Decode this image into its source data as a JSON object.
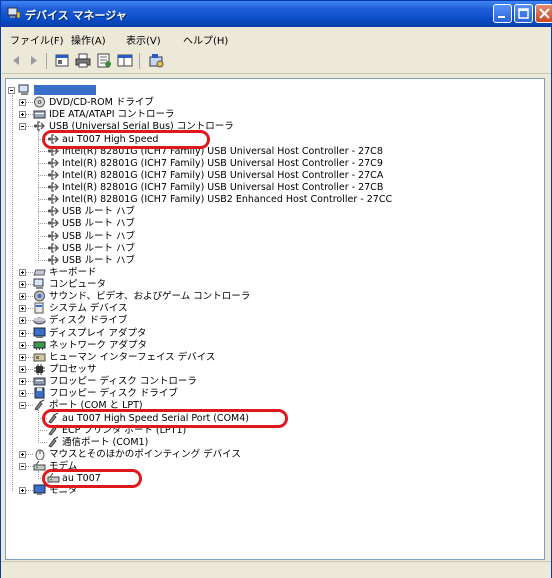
{
  "window": {
    "title": "デバイス マネージャ"
  },
  "menu": [
    "ファイル(F)",
    "操作(A)",
    "表示(V)",
    "ヘルプ(H)"
  ],
  "toolbar": [
    "back-icon",
    "forward-icon",
    "show-icon",
    "print-icon",
    "properties-icon",
    "view-icon",
    "scan-icon"
  ],
  "tree": [
    {
      "label": "",
      "level": 0,
      "expander": "minus",
      "icon": "computer-icon",
      "kind": "root"
    },
    {
      "label": "DVD/CD-ROM ドライブ",
      "level": 1,
      "expander": "plus",
      "icon": "cdrom-icon"
    },
    {
      "label": "IDE ATA/ATAPI コントローラ",
      "level": 1,
      "expander": "plus",
      "icon": "ide-icon"
    },
    {
      "label": "USB (Universal Serial Bus) コントローラ",
      "level": 1,
      "expander": "minus",
      "icon": "usb-icon"
    },
    {
      "label": "au T007 High Speed",
      "level": 2,
      "icon": "usb-icon"
    },
    {
      "label": "Intel(R) 82801G (ICH7 Family) USB Universal Host Controller - 27C8",
      "level": 2,
      "icon": "usb-icon"
    },
    {
      "label": "Intel(R) 82801G (ICH7 Family) USB Universal Host Controller - 27C9",
      "level": 2,
      "icon": "usb-icon"
    },
    {
      "label": "Intel(R) 82801G (ICH7 Family) USB Universal Host Controller - 27CA",
      "level": 2,
      "icon": "usb-icon"
    },
    {
      "label": "Intel(R) 82801G (ICH7 Family) USB Universal Host Controller - 27CB",
      "level": 2,
      "icon": "usb-icon"
    },
    {
      "label": "Intel(R) 82801G (ICH7 Family) USB2 Enhanced Host Controller - 27CC",
      "level": 2,
      "icon": "usb-icon"
    },
    {
      "label": "USB ルート ハブ",
      "level": 2,
      "icon": "usb-icon"
    },
    {
      "label": "USB ルート ハブ",
      "level": 2,
      "icon": "usb-icon"
    },
    {
      "label": "USB ルート ハブ",
      "level": 2,
      "icon": "usb-icon"
    },
    {
      "label": "USB ルート ハブ",
      "level": 2,
      "icon": "usb-icon"
    },
    {
      "label": "USB ルート ハブ",
      "level": 2,
      "icon": "usb-icon"
    },
    {
      "label": "キーボード",
      "level": 1,
      "expander": "plus",
      "icon": "keyboard-icon"
    },
    {
      "label": "コンピュータ",
      "level": 1,
      "expander": "plus",
      "icon": "computer-icon"
    },
    {
      "label": "サウンド、ビデオ、およびゲーム コントローラ",
      "level": 1,
      "expander": "plus",
      "icon": "sound-icon"
    },
    {
      "label": "システム デバイス",
      "level": 1,
      "expander": "plus",
      "icon": "system-icon"
    },
    {
      "label": "ディスク ドライブ",
      "level": 1,
      "expander": "plus",
      "icon": "disk-icon"
    },
    {
      "label": "ディスプレイ アダプタ",
      "level": 1,
      "expander": "plus",
      "icon": "display-icon"
    },
    {
      "label": "ネットワーク アダプタ",
      "level": 1,
      "expander": "plus",
      "icon": "network-icon"
    },
    {
      "label": "ヒューマン インターフェイス デバイス",
      "level": 1,
      "expander": "plus",
      "icon": "hid-icon"
    },
    {
      "label": "プロセッサ",
      "level": 1,
      "expander": "plus",
      "icon": "cpu-icon"
    },
    {
      "label": "フロッピー ディスク コントローラ",
      "level": 1,
      "expander": "plus",
      "icon": "floppy-controller-icon"
    },
    {
      "label": "フロッピー ディスク ドライブ",
      "level": 1,
      "expander": "plus",
      "icon": "floppy-icon"
    },
    {
      "label": "ポート (COM と LPT)",
      "level": 1,
      "expander": "minus",
      "icon": "port-icon"
    },
    {
      "label": "au T007 High Speed Serial Port  (COM4)",
      "level": 2,
      "icon": "port-icon"
    },
    {
      "label": "ECP プリンタ ポート (LPT1)",
      "level": 2,
      "icon": "port-icon"
    },
    {
      "label": "通信ポート (COM1)",
      "level": 2,
      "icon": "port-icon"
    },
    {
      "label": "マウスとそのほかのポインティング デバイス",
      "level": 1,
      "expander": "plus",
      "icon": "mouse-icon"
    },
    {
      "label": "モデム",
      "level": 1,
      "expander": "minus",
      "icon": "modem-icon"
    },
    {
      "label": "au T007",
      "level": 2,
      "icon": "modem-icon"
    },
    {
      "label": "モニタ",
      "level": 1,
      "expander": "plus",
      "icon": "monitor-icon"
    }
  ],
  "highlights": [
    "au T007 High Speed",
    "au T007 High Speed Serial Port  (COM4)",
    "au T007"
  ],
  "colors": {
    "title_bar": "#0a4cc8",
    "highlight": "#e0181e",
    "tree_line": "#a0a0a0"
  }
}
